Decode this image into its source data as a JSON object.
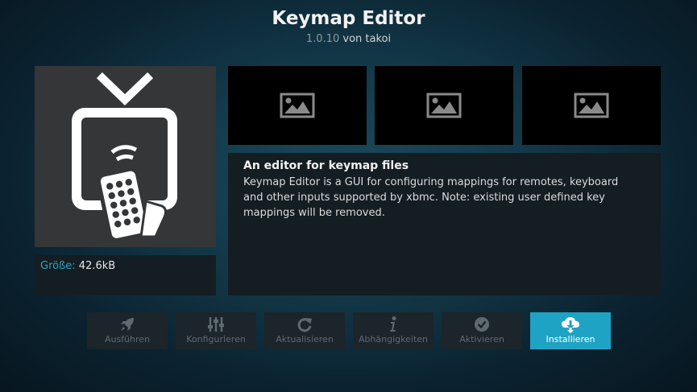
{
  "addon": {
    "title": "Keymap Editor",
    "version": "1.0.10",
    "author_text": "von takoi"
  },
  "info": {
    "size_label": "Größe:",
    "size_value": "42.6kB"
  },
  "description": {
    "heading": "An editor for keymap files",
    "text": "Keymap Editor is a GUI for configuring mappings for remotes, keyboard and other inputs supported by xbmc. Note: existing user defined key mappings will be removed."
  },
  "screenshots": [
    {
      "icon": "image-placeholder-icon"
    },
    {
      "icon": "image-placeholder-icon"
    },
    {
      "icon": "image-placeholder-icon"
    }
  ],
  "buttons": [
    {
      "label": "Ausführen",
      "icon": "rocket-icon",
      "enabled": false
    },
    {
      "label": "Konfigurieren",
      "icon": "sliders-icon",
      "enabled": false
    },
    {
      "label": "Aktualisieren",
      "icon": "refresh-icon",
      "enabled": false
    },
    {
      "label": "Abhängigkeiten",
      "icon": "info-icon",
      "enabled": false
    },
    {
      "label": "Aktivieren",
      "icon": "check-circle-icon",
      "enabled": false
    },
    {
      "label": "Installieren",
      "icon": "cloud-download-icon",
      "enabled": true
    }
  ],
  "colors": {
    "accent": "#1fa3c4",
    "size_label": "#2aa7c8",
    "panel": "#141d22",
    "button": "#1b252a"
  }
}
